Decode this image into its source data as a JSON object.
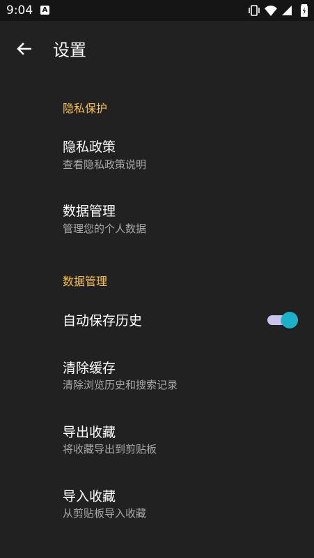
{
  "status_bar": {
    "time": "9:04",
    "app_indicator": "A"
  },
  "header": {
    "title": "设置",
    "back_icon": "arrow-left-icon"
  },
  "sections": [
    {
      "title": "隐私保护",
      "items": [
        {
          "title": "隐私政策",
          "subtitle": "查看隐私政策说明"
        },
        {
          "title": "数据管理",
          "subtitle": "管理您的个人数据"
        }
      ]
    },
    {
      "title": "数据管理",
      "items": [
        {
          "title": "自动保存历史",
          "toggle_on": true
        },
        {
          "title": "清除缓存",
          "subtitle": "清除浏览历史和搜索记录"
        },
        {
          "title": "导出收藏",
          "subtitle": "将收藏导出到剪贴板"
        },
        {
          "title": "导入收藏",
          "subtitle": "从剪贴板导入收藏"
        }
      ]
    }
  ],
  "colors": {
    "accent": "#f7c046",
    "background": "#212121",
    "toggle_thumb": "#19b2c9",
    "toggle_track": "#c9c3ee"
  }
}
